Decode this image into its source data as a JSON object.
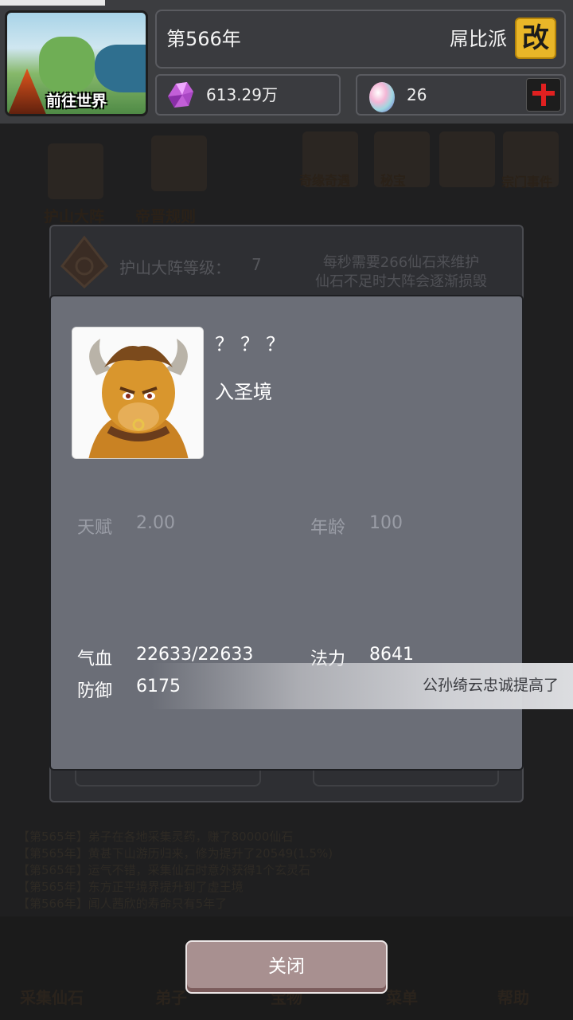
{
  "header": {
    "world_button_label": "前往世界",
    "year": "第566年",
    "sect_name": "屌比派",
    "rename_button_label": "改",
    "spirit_stones": "613.29万",
    "eggs": "26",
    "icons": {
      "world": "world-map-icon",
      "stone": "crystal-icon",
      "egg": "egg-icon",
      "add": "plus-icon"
    },
    "colors": {
      "rename_bg": "#e9b628",
      "add_plus": "#e02020"
    }
  },
  "background": {
    "top_icons": [
      "护山大阵",
      "帝晋规则",
      "奇缘奇遇",
      "秘宝",
      "宗门事件"
    ],
    "formation": {
      "level_label": "护山大阵等级：",
      "level_value": "7",
      "desc_line1": "每秒需要266仙石来维护",
      "desc_line2": "仙石不足时大阵会逐渐损毁"
    },
    "log": [
      "【第565年】弟子在各地采集灵药，赚了80000仙石",
      "【第565年】黄甚下山游历归来，修为提升了20549(1.5%)",
      "【第565年】运气不错，采集仙石时意外获得1个玄灵石",
      "【第565年】东方正平境界提升到了虚王境",
      "【第566年】闻人茜欣的寿命只有5年了"
    ],
    "nav": [
      "采集仙石",
      "弟子",
      "宝物",
      "菜单",
      "帮助"
    ]
  },
  "dialog": {
    "name": "？？？",
    "realm": "入圣境",
    "portrait_icon": "minotaur-portrait",
    "talent_label": "天赋",
    "talent_value": "2.00",
    "age_label": "年龄",
    "age_value": "100",
    "hp_label": "气血",
    "hp_value": "22633/22633",
    "mana_label": "法力",
    "mana_value": "8641",
    "def_label": "防御",
    "def_value": "6175",
    "close_label": "关闭"
  },
  "toast": {
    "text": "公孙绮云忠诚提高了"
  }
}
